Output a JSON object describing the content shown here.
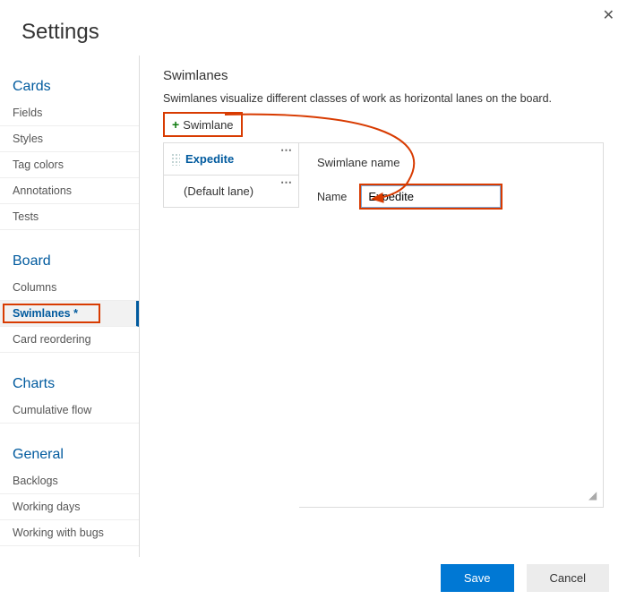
{
  "dialog": {
    "title": "Settings",
    "close": "✕"
  },
  "sidebar": {
    "sections": [
      {
        "header": "Cards",
        "items": [
          {
            "label": "Fields"
          },
          {
            "label": "Styles"
          },
          {
            "label": "Tag colors"
          },
          {
            "label": "Annotations"
          },
          {
            "label": "Tests"
          }
        ]
      },
      {
        "header": "Board",
        "items": [
          {
            "label": "Columns"
          },
          {
            "label": "Swimlanes *",
            "active": true
          },
          {
            "label": "Card reordering"
          }
        ]
      },
      {
        "header": "Charts",
        "items": [
          {
            "label": "Cumulative flow"
          }
        ]
      },
      {
        "header": "General",
        "items": [
          {
            "label": "Backlogs"
          },
          {
            "label": "Working days"
          },
          {
            "label": "Working with bugs"
          }
        ]
      }
    ]
  },
  "main": {
    "title": "Swimlanes",
    "description": "Swimlanes visualize different classes of work as horizontal lanes on the board.",
    "addButton": "Swimlane",
    "lanes": [
      {
        "label": "Expedite",
        "selected": true
      },
      {
        "label": "(Default lane)"
      }
    ],
    "detail": {
      "heading": "Swimlane name",
      "nameLabel": "Name",
      "nameValue": "Expedite"
    }
  },
  "footer": {
    "save": "Save",
    "cancel": "Cancel"
  },
  "colors": {
    "accent": "#0078d4",
    "annotation": "#d83b01"
  }
}
